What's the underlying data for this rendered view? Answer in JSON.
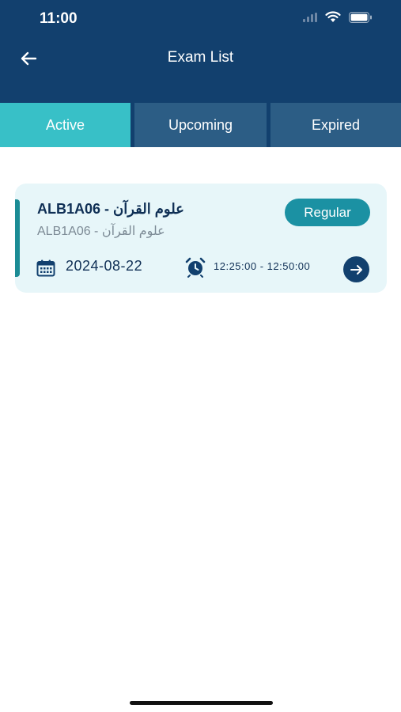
{
  "status_bar": {
    "time": "11:00"
  },
  "header": {
    "title": "Exam List"
  },
  "tabs": [
    {
      "label": "Active",
      "active": true
    },
    {
      "label": "Upcoming",
      "active": false
    },
    {
      "label": "Expired",
      "active": false
    }
  ],
  "exams": [
    {
      "title": "ALB1A06 - علوم القرآن",
      "subtitle": "ALB1A06 - علوم القرآن",
      "type": "Regular",
      "date": "2024-08-22",
      "time_range": "12:25:00 - 12:50:00"
    }
  ],
  "colors": {
    "header_bg": "#12406e",
    "active_tab": "#38c0c7",
    "inactive_tab": "#2c5d85",
    "card_bg": "#e7f6f9",
    "badge": "#1b91a3"
  },
  "icons": [
    "back-arrow-icon",
    "calendar-icon",
    "alarm-clock-icon",
    "arrow-right-icon",
    "wifi-icon",
    "battery-icon",
    "signal-icon"
  ]
}
